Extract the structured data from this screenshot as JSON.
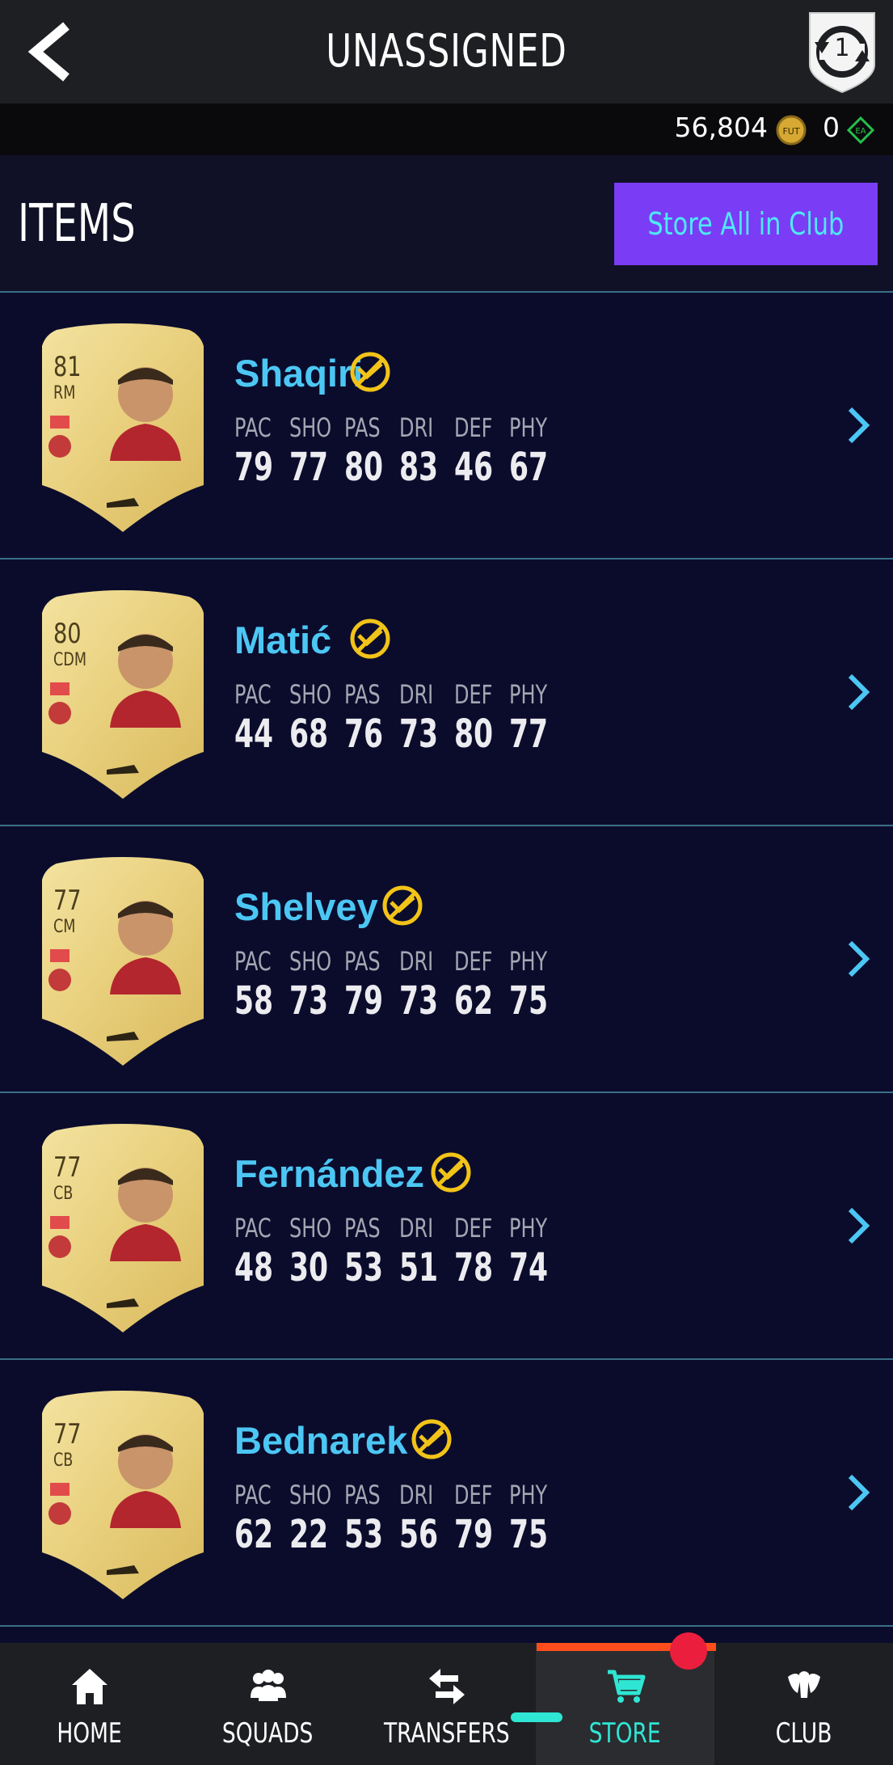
{
  "header": {
    "title": "UNASSIGNED",
    "shield_count": "1"
  },
  "currency": {
    "coins": "56,804",
    "coin_label": "FUT",
    "points": "0",
    "points_label": "EA"
  },
  "items": {
    "title": "ITEMS",
    "store_all_label": "Store All in Club"
  },
  "stat_headers": [
    "PAC",
    "SHO",
    "PAS",
    "DRI",
    "DEF",
    "PHY"
  ],
  "players": [
    {
      "name": "Shaqiri",
      "rating": "81",
      "position": "RM",
      "stats": [
        "79",
        "77",
        "80",
        "83",
        "46",
        "67"
      ]
    },
    {
      "name": "Matić",
      "rating": "80",
      "position": "CDM",
      "stats": [
        "44",
        "68",
        "76",
        "73",
        "80",
        "77"
      ]
    },
    {
      "name": "Shelvey",
      "rating": "77",
      "position": "CM",
      "stats": [
        "58",
        "73",
        "79",
        "73",
        "62",
        "75"
      ]
    },
    {
      "name": "Fernández",
      "rating": "77",
      "position": "CB",
      "stats": [
        "48",
        "30",
        "53",
        "51",
        "78",
        "74"
      ]
    },
    {
      "name": "Bednarek",
      "rating": "77",
      "position": "CB",
      "stats": [
        "62",
        "22",
        "53",
        "56",
        "79",
        "75"
      ]
    }
  ],
  "nav": {
    "home": "HOME",
    "squads": "SQUADS",
    "transfers": "TRANSFERS",
    "store": "STORE",
    "club": "CLUB",
    "active": "store"
  },
  "colors": {
    "accent_purple": "#7b3cf5",
    "name_blue": "#4cc7f4",
    "active_teal": "#2ee6d3",
    "active_bar": "#ff4e1c",
    "untradeable_gold": "#f2c318"
  }
}
